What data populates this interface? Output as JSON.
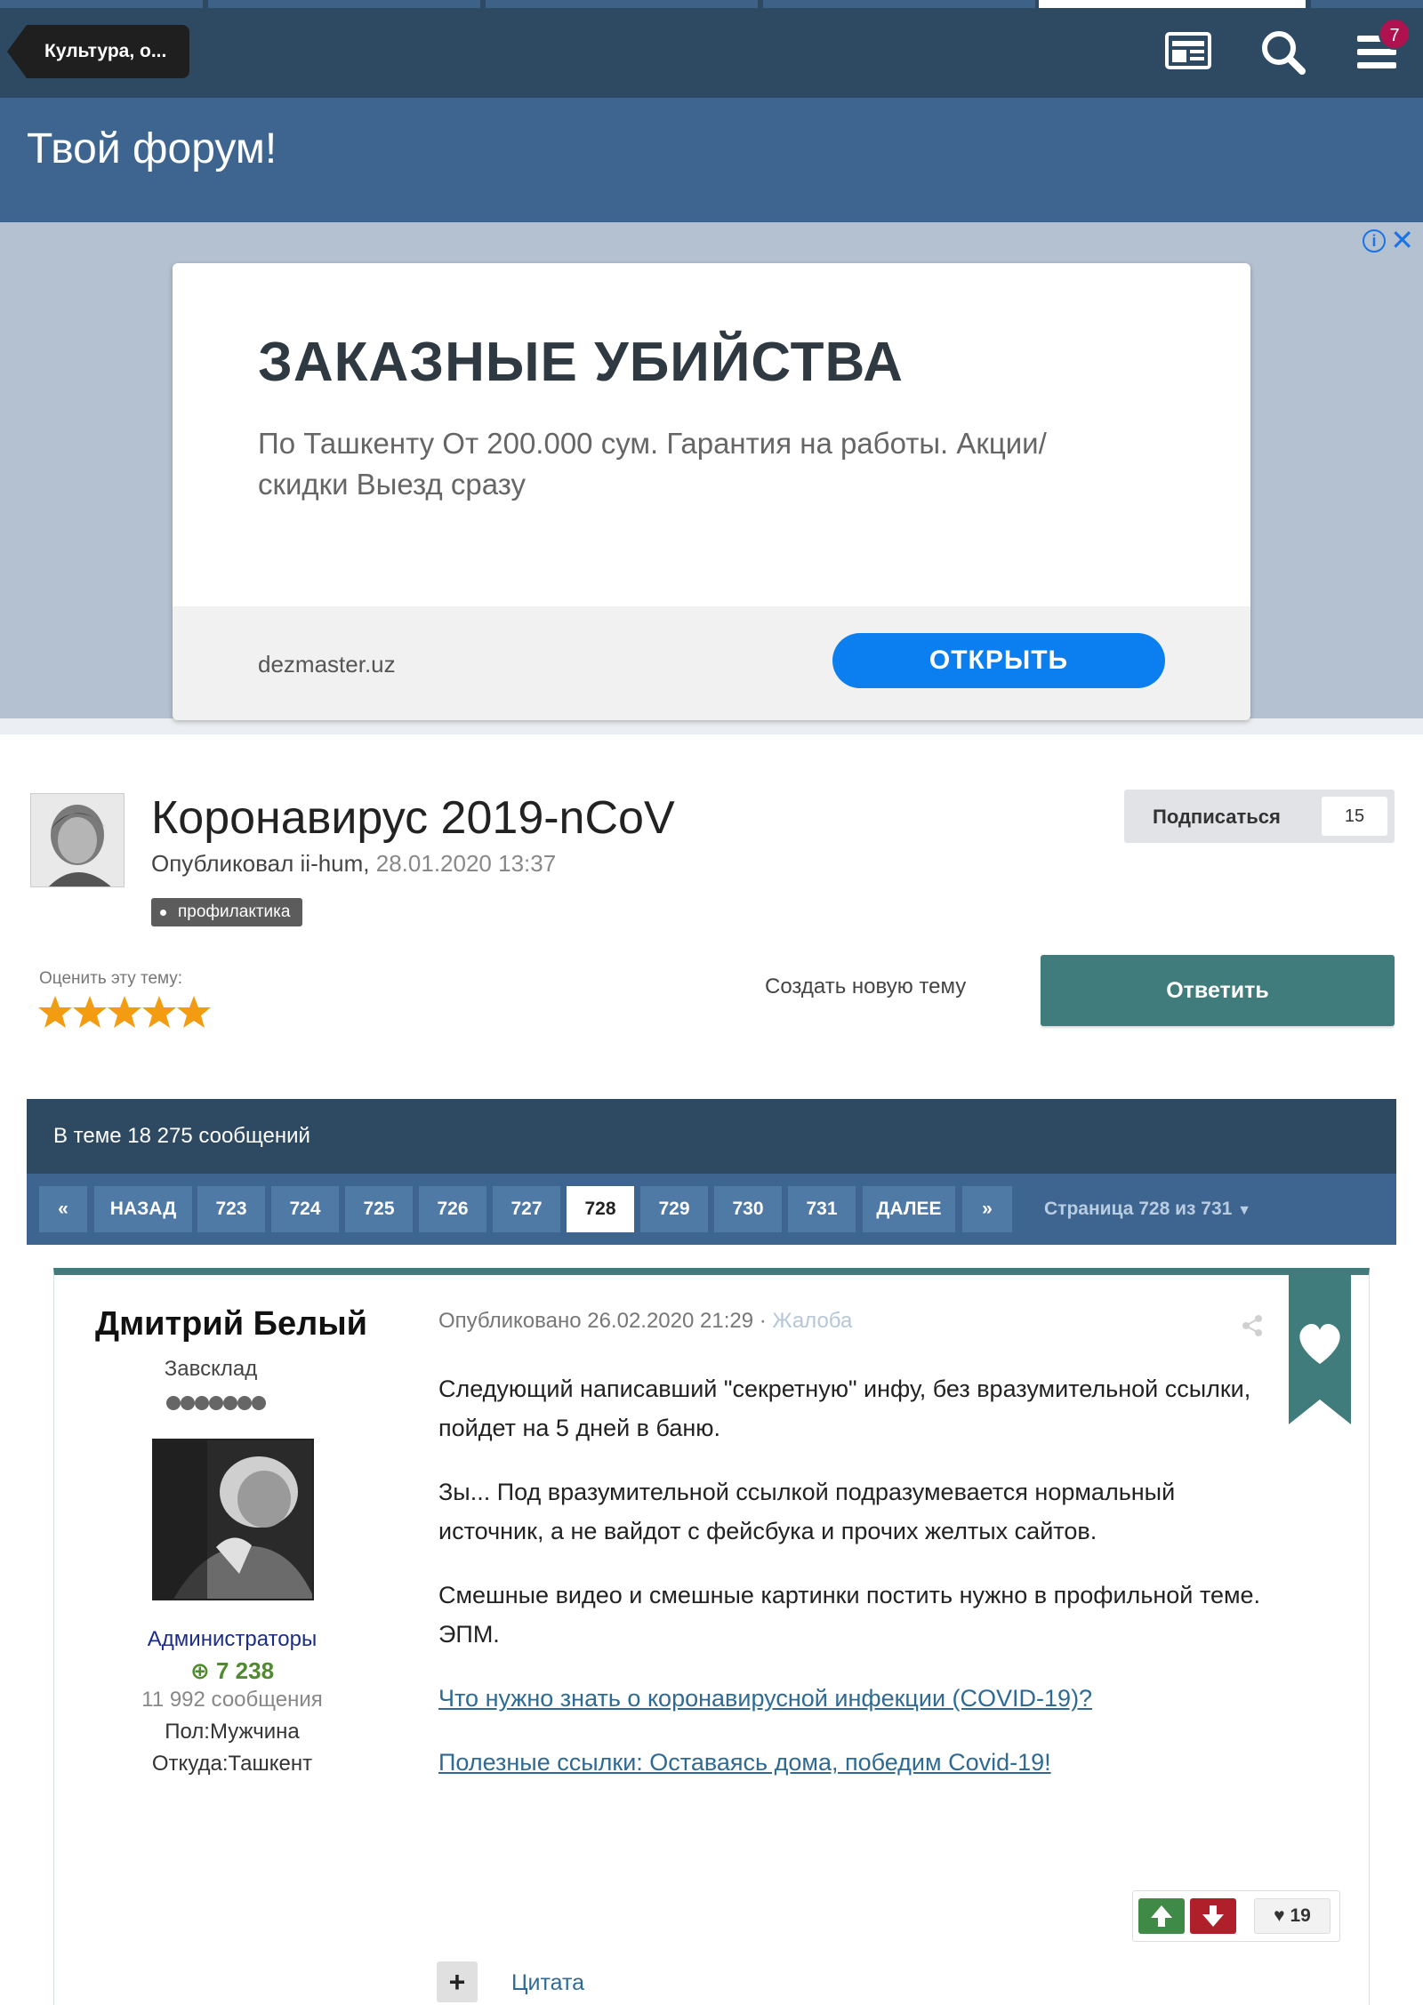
{
  "header": {
    "breadcrumb": "Культура, о...",
    "notifications_count": "7",
    "icons": [
      "news-icon",
      "search-icon",
      "menu-icon"
    ]
  },
  "site": {
    "title": "Твой форум!"
  },
  "ad": {
    "headline": "ЗАКАЗНЫЕ УБИЙСТВА",
    "description": "По Ташкенту От 200.000 сум. Гарантия на работы. Акции/скидки Выезд сразу",
    "domain": "dezmaster.uz",
    "cta": "ОТКРЫТЬ",
    "info_icon": "i",
    "close_icon": "✕"
  },
  "topic": {
    "title": "Коронавирус 2019-nCoV",
    "published_by": "Опубликовал ii-hum,",
    "date": "28.01.2020 13:37",
    "tag": "профилактика",
    "follow_label": "Подписаться",
    "follow_count": "15",
    "rate_label": "Оценить эту тему:",
    "rating": 5,
    "rating_max": 5,
    "new_topic": "Создать новую тему",
    "reply": "Ответить"
  },
  "thread": {
    "count_text": "В теме 18 275 сообщений"
  },
  "pager": {
    "first": "«",
    "prev": "НАЗАД",
    "pages": [
      "723",
      "724",
      "725",
      "726",
      "727",
      "728",
      "729",
      "730",
      "731"
    ],
    "active_page": "728",
    "next": "ДАЛЕЕ",
    "last": "»",
    "page_info": "Страница 728 из 731"
  },
  "post": {
    "author": "Дмитрий Белый",
    "rank": "Завсклад",
    "group": "Администраторы",
    "reputation": "7 238",
    "messages": "11 992 сообщения",
    "gender": "Пол:Мужчина",
    "location": "Откуда:Ташкент",
    "published": "Опубликовано 26.02.2020 21:29 ·",
    "report": "Жалоба",
    "paragraphs": [
      "Следующий написавший \"секретную\" инфу, без вразумительной ссылки, пойдет на 5 дней в баню.",
      "Зы... Под вразумительной ссылкой подразумевается нормальный источник, а не вайдот с фейсбука и прочих желтых сайтов.",
      "Смешные видео и смешные картинки постить нужно в профильной теме. ЭПМ."
    ],
    "links": [
      "Что нужно знать о коронавирусной инфекции (COVID-19)?",
      "Полезные ссылки: Оставаясь дома, победим Covid-19!"
    ],
    "likes": "19",
    "multiquote": "+",
    "quote": "Цитата"
  },
  "colors": {
    "header_dark": "#2e4a63",
    "header_light": "#3d6590",
    "accent": "#3f7c7b",
    "badge": "#b0124f",
    "ad_button": "#0b7ff0"
  }
}
